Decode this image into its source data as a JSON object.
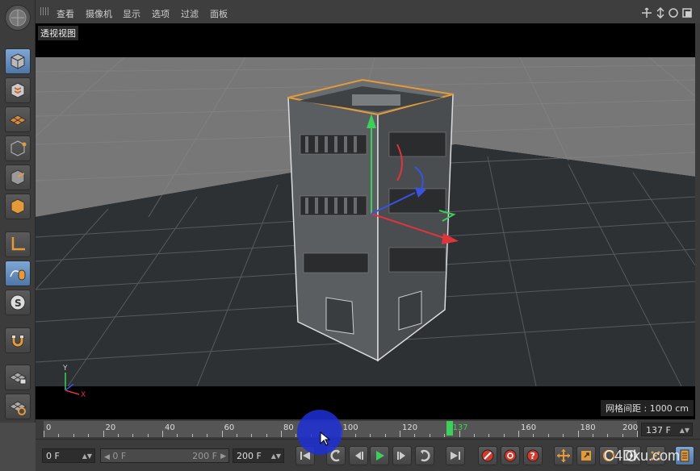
{
  "menubar": {
    "items": [
      "查看",
      "摄像机",
      "显示",
      "选项",
      "过滤",
      "面板"
    ]
  },
  "viewport": {
    "label": "透视视图",
    "grid_spacing": "网格间距 : 1000 cm",
    "axis_x": "X",
    "axis_y": "Y"
  },
  "timeline": {
    "ticks": [
      "0",
      "20",
      "40",
      "60",
      "80",
      "100",
      "120",
      "137",
      "160",
      "180",
      "200"
    ],
    "current_frame": 137,
    "frame_display": "137 F"
  },
  "controls": {
    "start_field": "0 F",
    "range_start": "0 F",
    "range_end": "200 F",
    "end_field": "200 F"
  },
  "watermark": "C4Dku.com",
  "colors": {
    "accent_blue": "#4e77a8",
    "playhead": "#3ccf5c",
    "selection_outline": "#e59a3a"
  }
}
